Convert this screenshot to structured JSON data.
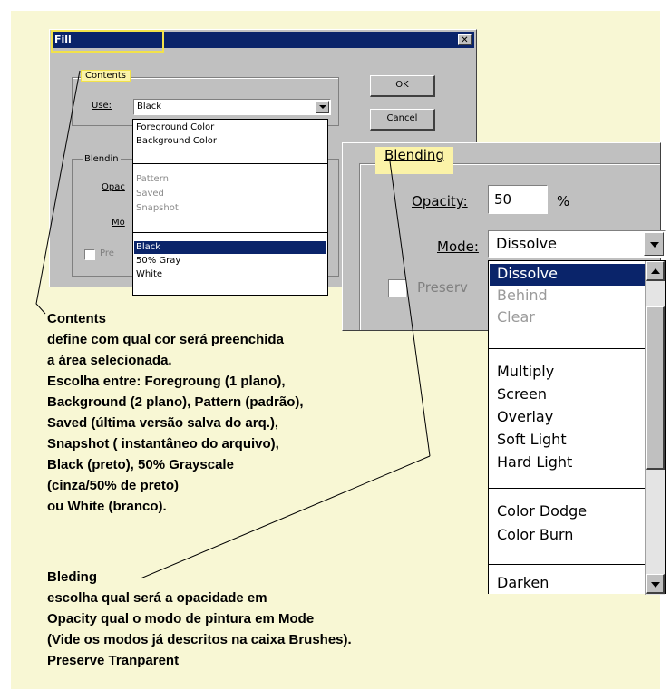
{
  "dialog": {
    "title": "Fill",
    "close": "✕",
    "ok_label": "OK",
    "cancel_label": "Cancel",
    "contents_label": "Contents",
    "use_label": "Use:",
    "use_value": "Black",
    "blending_label_partial": "Blendin",
    "opacity_partial": "Opac",
    "mode_partial": "Mo",
    "preserve_partial": "Pre"
  },
  "use_dropdown": {
    "groups": [
      [
        {
          "label": "Foreground Color",
          "enabled": true
        },
        {
          "label": "Background Color",
          "enabled": true
        }
      ],
      [
        {
          "label": "Pattern",
          "enabled": false
        },
        {
          "label": "Saved",
          "enabled": false
        },
        {
          "label": "Snapshot",
          "enabled": false
        }
      ],
      [
        {
          "label": "Black",
          "enabled": true,
          "selected": true
        },
        {
          "label": "50% Gray",
          "enabled": true
        },
        {
          "label": "White",
          "enabled": true
        }
      ]
    ]
  },
  "zoom": {
    "blending_label": "Blending",
    "opacity_label": "Opacity:",
    "opacity_value": "50",
    "opacity_unit": "%",
    "mode_label": "Mode:",
    "mode_value": "Dissolve",
    "preserve_partial": "Preserv",
    "mode_list": [
      {
        "label": "Dissolve",
        "selected": true,
        "enabled": true
      },
      {
        "label": "Behind",
        "enabled": false
      },
      {
        "label": "Clear",
        "enabled": false
      },
      {
        "label": "Multiply",
        "enabled": true
      },
      {
        "label": "Screen",
        "enabled": true
      },
      {
        "label": "Overlay",
        "enabled": true
      },
      {
        "label": "Soft Light",
        "enabled": true
      },
      {
        "label": "Hard Light",
        "enabled": true
      },
      {
        "label": "Color Dodge",
        "enabled": true
      },
      {
        "label": "Color Burn",
        "enabled": true
      },
      {
        "label": "Darken",
        "enabled": true
      }
    ]
  },
  "annotations": {
    "contents_lines": [
      "Contents",
      "define com qual cor será preenchida",
      "a área selecionada.",
      "Escolha entre:  Foregroung (1 plano),",
      "Background (2 plano), Pattern (padrão),",
      "Saved (última versão salva do arq.),",
      "Snapshot ( instantâneo do arquivo),",
      "Black (preto), 50% Grayscale",
      "(cinza/50% de preto)",
      "ou White (branco)."
    ],
    "blending_lines": [
      "Bleding",
      "escolha qual será a opacidade em",
      "Opacity qual o modo de pintura em Mode",
      "(Vide os modos já descritos na caixa Brushes).",
      "Preserve Tranparent"
    ]
  },
  "colors": {
    "background": "#f8f7d4",
    "titlebar": "#0a246a",
    "highlight": "#fbf3a8",
    "dialog": "#c0c0c0"
  }
}
